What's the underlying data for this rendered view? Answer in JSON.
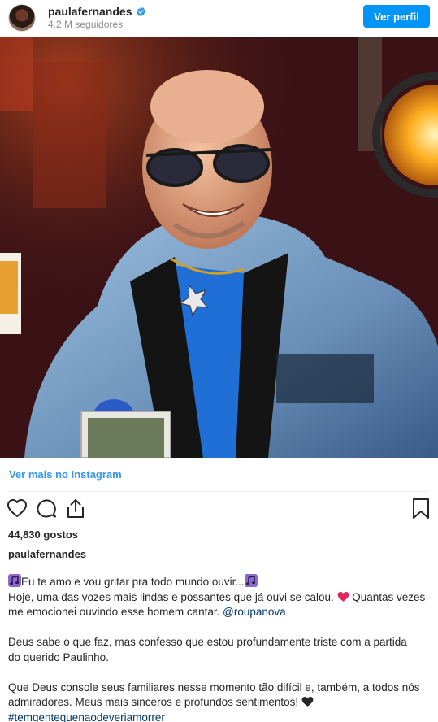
{
  "header": {
    "username": "paulafernandes",
    "followers": "4.2 M seguidores",
    "view_profile_label": "Ver perfil"
  },
  "post": {
    "view_more_label": "Ver mais no Instagram",
    "likes": "44,830 gostos",
    "caption_user": "paulafernandes",
    "caption": {
      "line1": "Eu te amo e vou gritar pra todo mundo ouvir...",
      "line2": "Hoje, uma das vozes mais lindas e possantes que já ouvi se calou.",
      "line2b": " Quantas vezes",
      "line3": "me emocionei ouvindo esse homem cantar. ",
      "mention": "@roupanova",
      "para2_line1": "Deus sabe o que faz, mas confesso que estou profundamente triste com a partida",
      "para2_line2": "do querido Paulinho.",
      "para3_line1": "Que Deus console seus familiares nesse momento tão difícil e, também, a todos nós",
      "para3_line2": "admiradores. Meus mais sinceros e profundos sentimentos!",
      "hashtag": "#temgentequenaodeveriamorrer"
    }
  },
  "colors": {
    "accent": "#0095f6",
    "link": "#3897f0",
    "hashtag": "#00376b",
    "verified": "#3897f0",
    "heart_emoji": "#e0245e"
  },
  "icons": {
    "verified": "verified-badge-icon",
    "like": "heart-outline-icon",
    "comment": "comment-icon",
    "share": "share-icon",
    "save": "bookmark-icon",
    "music": "music-notes-icon",
    "red_heart": "red-heart-icon",
    "black_heart": "black-heart-icon"
  }
}
